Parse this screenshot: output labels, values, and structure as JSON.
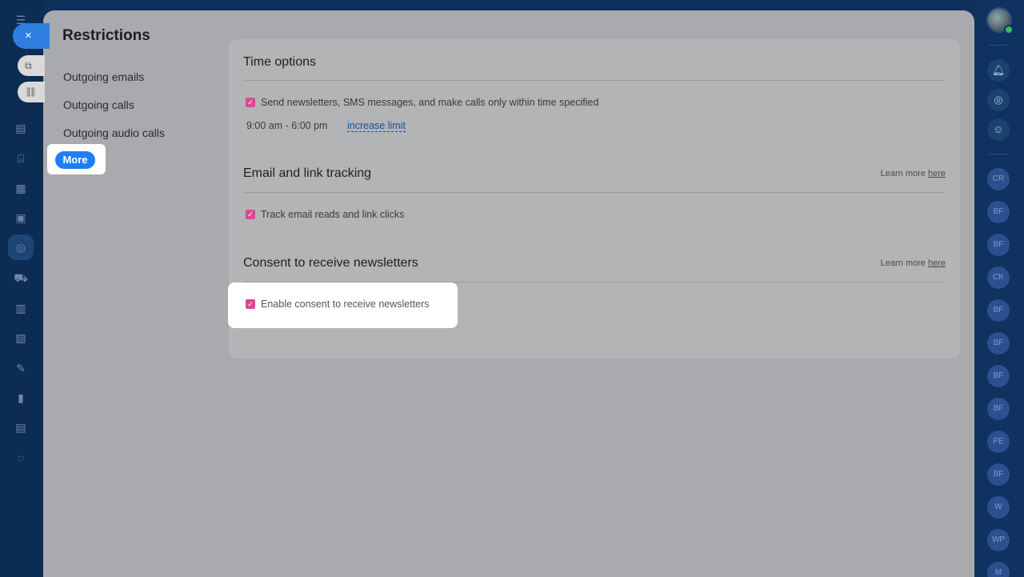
{
  "panel": {
    "title": "Restrictions",
    "menu": [
      {
        "label": "Outgoing emails"
      },
      {
        "label": "Outgoing calls"
      },
      {
        "label": "Outgoing audio calls"
      }
    ],
    "more_label": "More",
    "close_icon": "×"
  },
  "sections": {
    "time_options": {
      "title": "Time options",
      "checkbox_label": "Send newsletters, SMS messages, and make calls only within time specified",
      "checked": true,
      "time_range": "9:00 am - 6:00 pm",
      "link": "increase limit"
    },
    "email_tracking": {
      "title": "Email and link tracking",
      "learn_more_prefix": "Learn more",
      "learn_more_link": "here",
      "checkbox_label": "Track email reads and link clicks",
      "checked": true
    },
    "consent": {
      "title": "Consent to receive newsletters",
      "learn_more_prefix": "Learn more",
      "learn_more_link": "here",
      "checkbox_label": "Enable consent to receive newsletters",
      "checked": true
    }
  },
  "right_rail": {
    "contacts": [
      "CR",
      "BF",
      "BF",
      "CK",
      "BF",
      "BF",
      "BF",
      "BF",
      "PE",
      "BF",
      "W",
      "WP",
      "M"
    ]
  },
  "colors": {
    "accent": "#1f7ff0",
    "checkbox": "#d94a92",
    "link": "#1a4f93"
  }
}
